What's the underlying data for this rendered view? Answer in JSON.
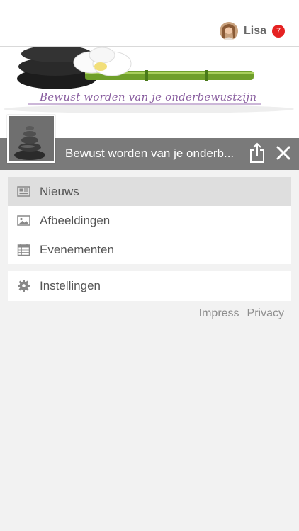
{
  "user": {
    "name": "Lisa",
    "notification_count": "7"
  },
  "banner": {
    "caption": "Bewust worden van je onderbewustzijn"
  },
  "header": {
    "title": "Bewust worden van je onderb..."
  },
  "menu": {
    "items": [
      {
        "label": "Nieuws",
        "icon": "newspaper-icon",
        "active": true
      },
      {
        "label": "Afbeeldingen",
        "icon": "image-icon",
        "active": false
      },
      {
        "label": "Evenementen",
        "icon": "calendar-icon",
        "active": false
      }
    ],
    "settings": {
      "label": "Instellingen",
      "icon": "gear-icon"
    }
  },
  "footer": {
    "impress": "Impress",
    "privacy": "Privacy"
  },
  "colors": {
    "header_bar": "#7a7a7a",
    "badge": "#e52222",
    "active_item": "#dedede",
    "background": "#f2f2f2"
  }
}
